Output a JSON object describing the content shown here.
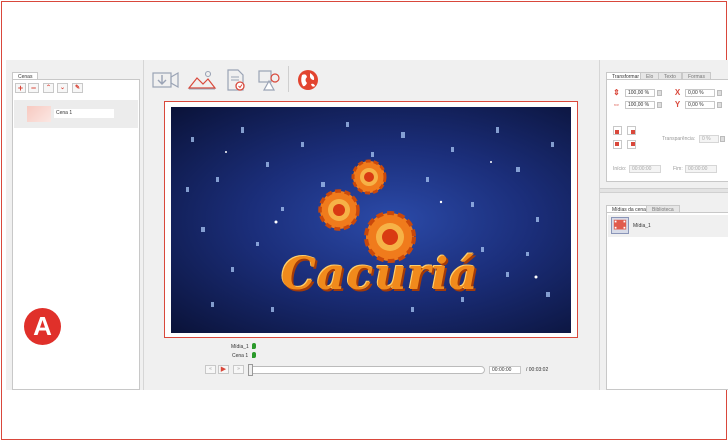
{
  "left_panel": {
    "tab_label": "Cenas",
    "toolbar": [
      "plus-icon",
      "minus-icon",
      "chevron-up-icon",
      "chevron-down-icon",
      "pencil-icon"
    ],
    "scenes": [
      {
        "name": "Cena 1"
      }
    ]
  },
  "badge": {
    "letter": "A",
    "color": "#e0302a"
  },
  "main_toolbar": [
    "import-video-icon",
    "image-icon",
    "document-icon",
    "shapes-icon",
    "globe-icon"
  ],
  "preview": {
    "title": "Cacuriá"
  },
  "tracks": [
    {
      "label": "Mídia_1"
    },
    {
      "label": "Cena 1"
    }
  ],
  "playback": {
    "current_time": "00:00:00",
    "total_time": "/ 00:03:02"
  },
  "properties": {
    "tabs": [
      "Transformar",
      "Elo",
      "Texto",
      "Formas"
    ],
    "width_percent": "100,00 %",
    "height_percent": "100,00 %",
    "x_value": "0,00 %",
    "y_value": "0,00 %",
    "transparency_label": "Transparência:",
    "transparency_value": "0 %",
    "start_label": "Início:",
    "start_value": "00:00:00",
    "end_label": "Fim:",
    "end_value": "00:00:00"
  },
  "media": {
    "tabs": [
      "Mídias da cena",
      "Biblioteca"
    ],
    "items": [
      {
        "name": "Mídia_1"
      }
    ]
  },
  "colors": {
    "accent": "#d9483b",
    "panel_bg": "#f0f0f0"
  }
}
